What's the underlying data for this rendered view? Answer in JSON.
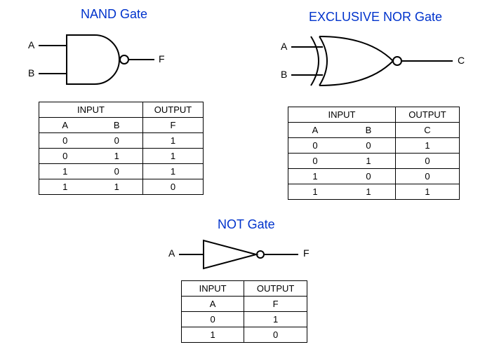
{
  "nand": {
    "title": "NAND Gate",
    "pins": {
      "a": "A",
      "b": "B",
      "out": "F"
    },
    "table": {
      "input_header": "INPUT",
      "output_header": "OUTPUT",
      "col_a": "A",
      "col_b": "B",
      "col_out": "F",
      "rows": [
        {
          "a": "0",
          "b": "0",
          "out": "1"
        },
        {
          "a": "0",
          "b": "1",
          "out": "1"
        },
        {
          "a": "1",
          "b": "0",
          "out": "1"
        },
        {
          "a": "1",
          "b": "1",
          "out": "0"
        }
      ]
    }
  },
  "xnor": {
    "title": "EXCLUSIVE NOR Gate",
    "pins": {
      "a": "A",
      "b": "B",
      "out": "C"
    },
    "table": {
      "input_header": "INPUT",
      "output_header": "OUTPUT",
      "col_a": "A",
      "col_b": "B",
      "col_out": "C",
      "rows": [
        {
          "a": "0",
          "b": "0",
          "out": "1"
        },
        {
          "a": "0",
          "b": "1",
          "out": "0"
        },
        {
          "a": "1",
          "b": "0",
          "out": "0"
        },
        {
          "a": "1",
          "b": "1",
          "out": "1"
        }
      ]
    }
  },
  "not": {
    "title": "NOT Gate",
    "pins": {
      "a": "A",
      "out": "F"
    },
    "table": {
      "input_header": "INPUT",
      "output_header": "OUTPUT",
      "col_a": "A",
      "col_out": "F",
      "rows": [
        {
          "a": "0",
          "out": "1"
        },
        {
          "a": "1",
          "out": "0"
        }
      ]
    }
  },
  "chart_data": [
    {
      "type": "table",
      "title": "NAND Gate truth table",
      "columns": [
        "A",
        "B",
        "F"
      ],
      "rows": [
        [
          0,
          0,
          1
        ],
        [
          0,
          1,
          1
        ],
        [
          1,
          0,
          1
        ],
        [
          1,
          1,
          0
        ]
      ]
    },
    {
      "type": "table",
      "title": "EXCLUSIVE NOR Gate truth table",
      "columns": [
        "A",
        "B",
        "C"
      ],
      "rows": [
        [
          0,
          0,
          1
        ],
        [
          0,
          1,
          0
        ],
        [
          1,
          0,
          0
        ],
        [
          1,
          1,
          1
        ]
      ]
    },
    {
      "type": "table",
      "title": "NOT Gate truth table",
      "columns": [
        "A",
        "F"
      ],
      "rows": [
        [
          0,
          1
        ],
        [
          1,
          0
        ]
      ]
    }
  ]
}
